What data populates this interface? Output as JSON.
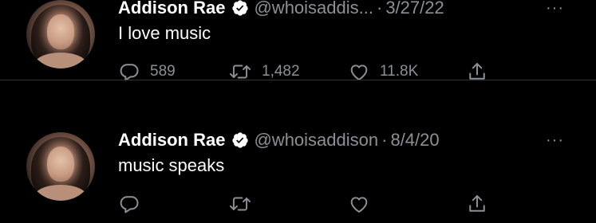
{
  "tweets": [
    {
      "name": "Addison Rae",
      "handle": "@whoisaddis...",
      "separator": "·",
      "date": "3/27/22",
      "more": "···",
      "text": "I love music",
      "replies": "589",
      "retweets": "1,482",
      "likes": "11.8K"
    },
    {
      "name": "Addison Rae",
      "handle": "@whoisaddison",
      "separator": "·",
      "date": "8/4/20",
      "more": "···",
      "text": "music speaks",
      "replies": "",
      "retweets": "",
      "likes": ""
    }
  ],
  "icons": {
    "verified": "verified-badge-icon",
    "reply": "reply-icon",
    "retweet": "retweet-icon",
    "like": "heart-icon",
    "share": "share-icon",
    "more": "more-icon"
  },
  "colors": {
    "background": "#000000",
    "text_primary": "#ffffff",
    "text_secondary": "#8b9096",
    "divider": "#2f3336"
  }
}
